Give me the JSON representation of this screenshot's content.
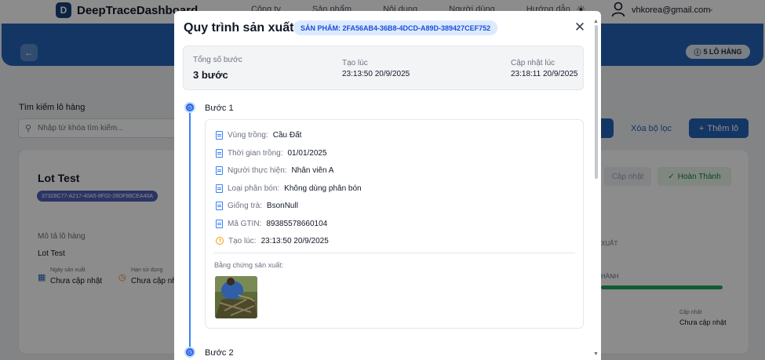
{
  "app": {
    "logo_letter": "D",
    "brand": "DeepTraceDashboard"
  },
  "nav": {
    "items": [
      "Công ty",
      "Sản phẩm",
      "Nội dung",
      "Người dùng",
      "Hướng dẫn"
    ]
  },
  "user": {
    "email": "vhkorea@gmail.com"
  },
  "header": {
    "lots_badge": "5 LÔ HÀNG"
  },
  "search": {
    "label": "Tìm kiếm lô hàng",
    "placeholder": "Nhập từ khóa tìm kiếm..."
  },
  "toolbar": {
    "search_tail": "n",
    "clear_label": "Xóa bộ lọc",
    "add_label": "Thêm lô"
  },
  "lot": {
    "title": "Lot Test",
    "id": "37328C77-A217-40A5-8F02-28DF88CEA40A",
    "desc_label": "Mô tả lô hàng",
    "desc_value": "Lot Test",
    "production_label": "Ngày sản xuất",
    "production_value": "Chưa cập nhật",
    "expiry_label": "Hạn sử dụng",
    "expiry_value": "Chưa cập nhật",
    "update_button": "Cập nhật",
    "complete_button": "Hoàn Thành",
    "side_label_1": "XUẤT",
    "side_label_2": "HÀNH",
    "progress": 1.0,
    "updated_label": "Cập nhật",
    "updated_value": "Chưa cập nhật"
  },
  "modal": {
    "title": "Quy trình sản xuất",
    "product_chip": "SẢN PHẨM: 2FA56AB4-36B8-4DCD-A89D-389427CEF752",
    "summary": {
      "steps_label": "Tổng số bước",
      "steps_value": "3 bước",
      "created_label": "Tạo lúc",
      "created_value": "23:13:50 20/9/2025",
      "updated_label": "Cập nhật lúc",
      "updated_value": "23:18:11 20/9/2025"
    },
    "step1": {
      "title": "Bước 1",
      "fields": [
        {
          "label": "Vùng trồng:",
          "value": "Cầu Đất"
        },
        {
          "label": "Thời gian trồng:",
          "value": "01/01/2025"
        },
        {
          "label": "Người thực hiện:",
          "value": "Nhân viên A"
        },
        {
          "label": "Loại phân bón:",
          "value": "Không dùng phân bón"
        },
        {
          "label": "Giống trà:",
          "value": "BsonNull"
        },
        {
          "label": "Mã GTIN:",
          "value": "89385578660104"
        },
        {
          "label": "Tạo lúc:",
          "value": "23:13:50 20/9/2025"
        }
      ],
      "evidence_label": "Bằng chứng sản xuất:"
    },
    "step2": {
      "title": "Bước 2"
    }
  },
  "colors": {
    "primary": "#2563b8",
    "success": "#22a85a",
    "chip_bg": "#dbeafe",
    "chip_text": "#1d4ed8"
  }
}
